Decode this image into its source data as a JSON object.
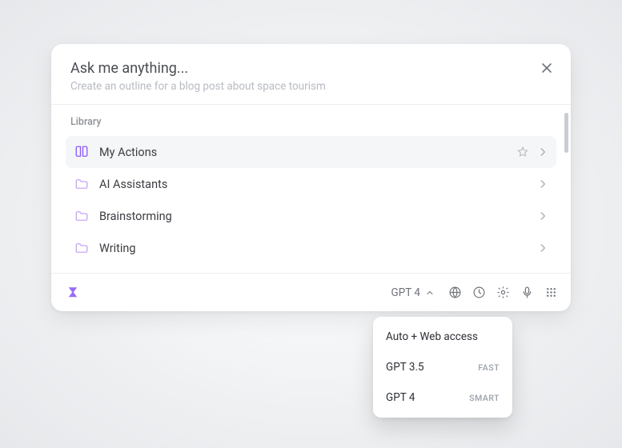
{
  "header": {
    "title": "Ask me anything...",
    "subtitle": "Create an outline for a blog post about space tourism"
  },
  "library": {
    "label": "Library",
    "items": [
      {
        "label": "My Actions",
        "icon": "book-open-icon",
        "selected": true,
        "starred": true
      },
      {
        "label": "AI Assistants",
        "icon": "folder-icon",
        "selected": false,
        "starred": false
      },
      {
        "label": "Brainstorming",
        "icon": "folder-icon",
        "selected": false,
        "starred": false
      },
      {
        "label": "Writing",
        "icon": "folder-icon",
        "selected": false,
        "starred": false
      }
    ]
  },
  "footer": {
    "model_label": "GPT 4"
  },
  "model_menu": {
    "items": [
      {
        "label": "Auto + Web access",
        "tag": ""
      },
      {
        "label": "GPT 3.5",
        "tag": "FAST"
      },
      {
        "label": "GPT 4",
        "tag": "SMART"
      }
    ]
  },
  "colors": {
    "accent": "#8b5cf6"
  }
}
